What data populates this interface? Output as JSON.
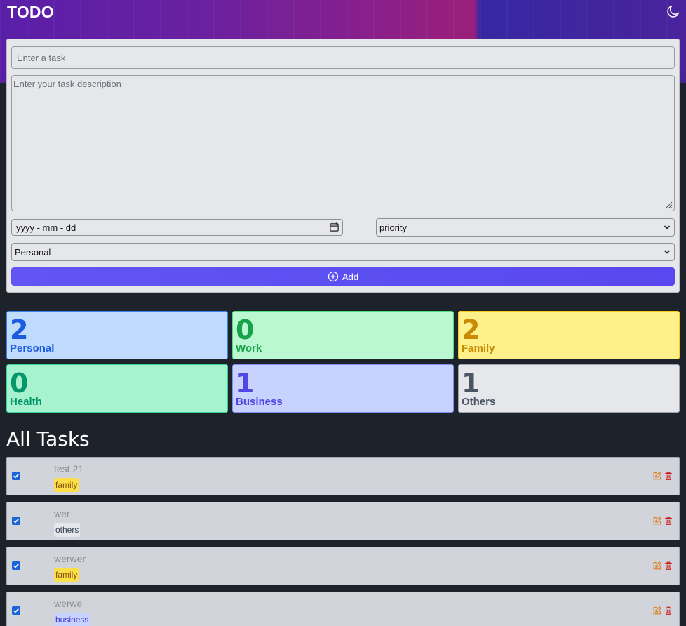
{
  "header": {
    "title": "TODO",
    "theme_icon": "moon-icon"
  },
  "form": {
    "task_placeholder": "Enter a task",
    "description_placeholder": "Enter your task description",
    "date_placeholder": "yyyy - mm - dd",
    "priority_selected": "priority",
    "category_selected": "Personal",
    "add_label": "Add",
    "add_color": "#5b4ef0"
  },
  "categories": [
    {
      "count": "2",
      "label": "Personal",
      "bg": "#bfdbfe",
      "fg": "#1d5ce0",
      "border": "#3b82f6"
    },
    {
      "count": "0",
      "label": "Work",
      "bg": "#bbf7d0",
      "fg": "#16a34a",
      "border": "#4ade80"
    },
    {
      "count": "2",
      "label": "Family",
      "bg": "#fef08a",
      "fg": "#ca8a04",
      "border": "#facc15"
    },
    {
      "count": "0",
      "label": "Health",
      "bg": "#a7f3d0",
      "fg": "#059669",
      "border": "#34d399"
    },
    {
      "count": "1",
      "label": "Business",
      "bg": "#c7d2fe",
      "fg": "#4f46e5",
      "border": "#818cf8"
    },
    {
      "count": "1",
      "label": "Others",
      "bg": "#e5e7eb",
      "fg": "#4b5563",
      "border": "#9ca3af"
    }
  ],
  "section_title": "All Tasks",
  "tasks": [
    {
      "title": "test 21",
      "tag": "family",
      "tag_bg": "#fde047",
      "tag_fg": "#854d0e",
      "done": true
    },
    {
      "title": "wer",
      "tag": "others",
      "tag_bg": "#e5e7eb",
      "tag_fg": "#374151",
      "done": true
    },
    {
      "title": "werwer",
      "tag": "family",
      "tag_bg": "#fde047",
      "tag_fg": "#854d0e",
      "done": true
    },
    {
      "title": "werwe",
      "tag": "business",
      "tag_bg": "#c7d2fe",
      "tag_fg": "#4338ca",
      "done": true
    }
  ],
  "icons": {
    "edit": "edit-icon",
    "delete": "trash-icon",
    "check": "checkbox-checked-icon"
  }
}
